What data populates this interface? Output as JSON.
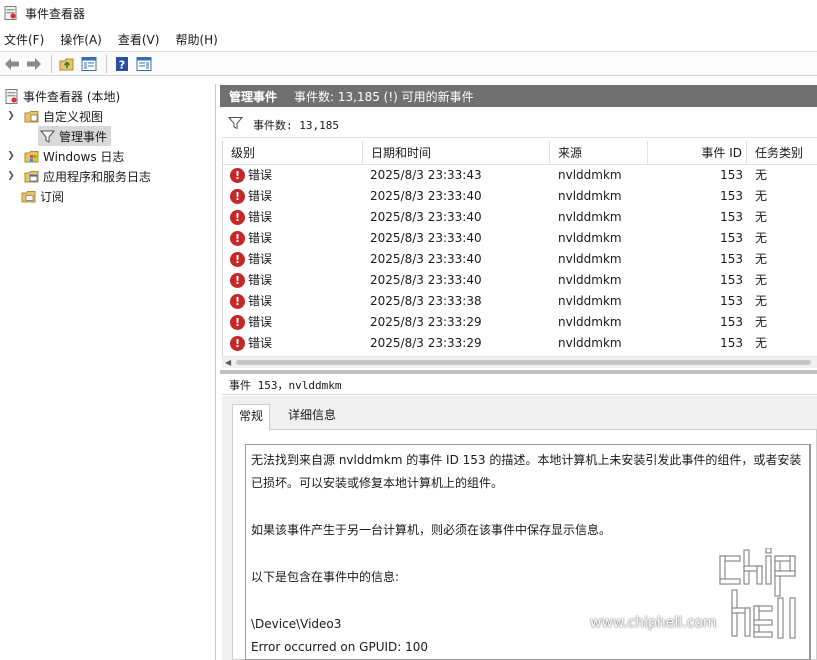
{
  "window": {
    "title": "事件查看器"
  },
  "menu": [
    {
      "label": "文件(F)"
    },
    {
      "label": "操作(A)"
    },
    {
      "label": "查看(V)"
    },
    {
      "label": "帮助(H)"
    }
  ],
  "toolbar": {
    "icons": [
      "back-arrow-icon",
      "forward-arrow-icon",
      "up-folder-icon",
      "show-hide-tree-icon",
      "help-icon",
      "show-hide-action-pane-icon"
    ]
  },
  "tree": {
    "root": "事件查看器 (本地)",
    "custom_views": "自定义视图",
    "admin_events": "管理事件",
    "windows_logs": "Windows 日志",
    "app_service_logs": "应用程序和服务日志",
    "subscriptions": "订阅"
  },
  "header": {
    "title": "管理事件",
    "summary": "事件数: 13,185 (!) 可用的新事件"
  },
  "filter": {
    "count_label": "事件数: 13,185"
  },
  "columns": [
    "级别",
    "日期和时间",
    "来源",
    "事件 ID",
    "任务类别"
  ],
  "events": [
    {
      "level": "错误",
      "datetime": "2025/8/3 23:33:43",
      "source": "nvlddmkm",
      "event_id": "153",
      "task": "无"
    },
    {
      "level": "错误",
      "datetime": "2025/8/3 23:33:40",
      "source": "nvlddmkm",
      "event_id": "153",
      "task": "无"
    },
    {
      "level": "错误",
      "datetime": "2025/8/3 23:33:40",
      "source": "nvlddmkm",
      "event_id": "153",
      "task": "无"
    },
    {
      "level": "错误",
      "datetime": "2025/8/3 23:33:40",
      "source": "nvlddmkm",
      "event_id": "153",
      "task": "无"
    },
    {
      "level": "错误",
      "datetime": "2025/8/3 23:33:40",
      "source": "nvlddmkm",
      "event_id": "153",
      "task": "无"
    },
    {
      "level": "错误",
      "datetime": "2025/8/3 23:33:40",
      "source": "nvlddmkm",
      "event_id": "153",
      "task": "无"
    },
    {
      "level": "错误",
      "datetime": "2025/8/3 23:33:38",
      "source": "nvlddmkm",
      "event_id": "153",
      "task": "无"
    },
    {
      "level": "错误",
      "datetime": "2025/8/3 23:33:29",
      "source": "nvlddmkm",
      "event_id": "153",
      "task": "无"
    },
    {
      "level": "错误",
      "datetime": "2025/8/3 23:33:29",
      "source": "nvlddmkm",
      "event_id": "153",
      "task": "无"
    }
  ],
  "detail": {
    "title": "事件 153，nvlddmkm",
    "tabs": [
      "常规",
      "详细信息"
    ],
    "message_lines": [
      "无法找到来自源 nvlddmkm 的事件 ID 153 的描述。本地计算机上未安装引发此事件的组件，或者安装",
      "已损坏。可以安装或修复本地计算机上的组件。",
      "",
      "如果该事件产生于另一台计算机，则必须在该事件中保存显示信息。",
      "",
      "以下是包含在事件中的信息:",
      "",
      "\\Device\\Video3",
      "Error occurred on GPUID: 100"
    ]
  },
  "watermark": {
    "url": "www.chiphell.com",
    "logo_text": "chip hell"
  },
  "colors": {
    "header_bg": "#707070",
    "error_red": "#c62828",
    "selected_bg": "#d9d9d9"
  }
}
